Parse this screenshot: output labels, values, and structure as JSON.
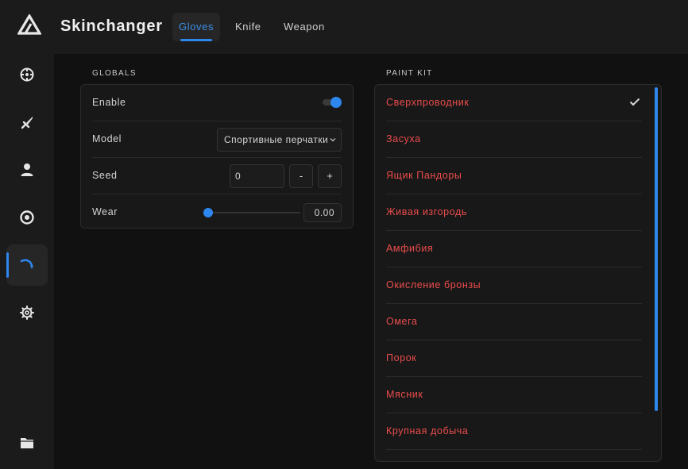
{
  "app": {
    "title": "Skinchanger"
  },
  "tabs": [
    {
      "label": "Gloves",
      "active": true
    },
    {
      "label": "Knife",
      "active": false
    },
    {
      "label": "Weapon",
      "active": false
    }
  ],
  "sidebar": {
    "items": [
      {
        "icon": "crosshair-icon"
      },
      {
        "icon": "sword-icon"
      },
      {
        "icon": "user-icon"
      },
      {
        "icon": "eye-icon"
      },
      {
        "icon": "skin-brush-icon",
        "active": true
      },
      {
        "icon": "gear-icon"
      }
    ],
    "bottom_icon": "folder-icon"
  },
  "globals": {
    "title": "GLOBALS",
    "enable_label": "Enable",
    "enable_on": true,
    "model_label": "Model",
    "model_value": "Спортивные перчатки",
    "seed_label": "Seed",
    "seed_value": "0",
    "seed_minus": "-",
    "seed_plus": "+",
    "wear_label": "Wear",
    "wear_value": "0.00",
    "wear_fraction": 0.0
  },
  "paint_kit": {
    "title": "PAINT KIT",
    "selected_index": 0,
    "items": [
      "Сверхпроводник",
      "Засуха",
      "Ящик Пандоры",
      "Живая изгородь",
      "Амфибия",
      "Окисление бронзы",
      "Омега",
      "Порок",
      "Мясник",
      "Крупная добыча"
    ]
  },
  "colors": {
    "accent": "#2e86ef",
    "list_text": "#ec4c4c",
    "background": "#111111",
    "panel": "#181818"
  }
}
